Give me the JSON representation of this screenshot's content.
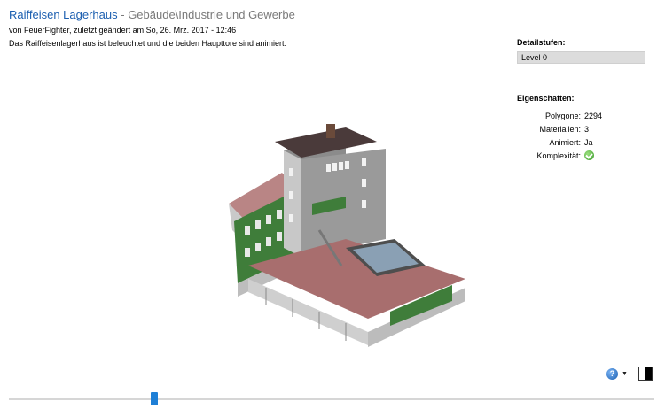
{
  "header": {
    "title": "Raiffeisen Lagerhaus",
    "separator": " - ",
    "category": "Gebäude\\Industrie und Gewerbe",
    "byline": "von FeuerFighter, zuletzt geändert am So, 26. Mrz. 2017 - 12:46"
  },
  "description": "Das Raiffeisenlagerhaus ist beleuchtet und die beiden Haupttore sind animiert.",
  "detail": {
    "heading": "Detailstufen:",
    "level": "Level 0"
  },
  "properties": {
    "heading": "Eigenschaften:",
    "polygone_label": "Polygone:",
    "polygone_value": "2294",
    "materialien_label": "Materialien:",
    "materialien_value": "3",
    "animiert_label": "Animiert:",
    "animiert_value": "Ja",
    "komplexitaet_label": "Komplexität:",
    "komplexitaet_icon": "check-circle-icon"
  },
  "slider": {
    "value": 0.22
  },
  "colors": {
    "accent": "#1c5fb0",
    "slider": "#1e7fd6",
    "check": "#3a9a2a"
  }
}
